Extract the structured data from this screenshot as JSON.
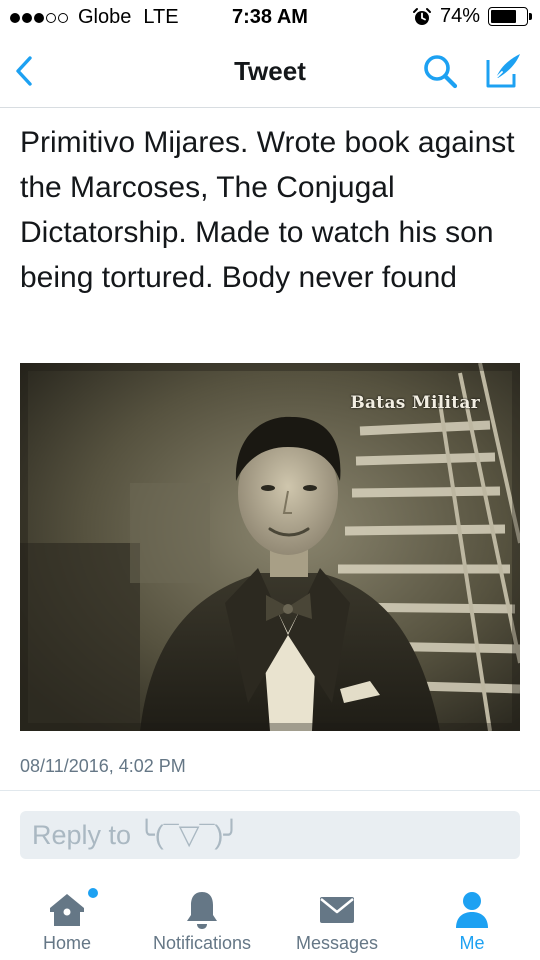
{
  "status_bar": {
    "carrier": "Globe",
    "network": "LTE",
    "time": "7:38 AM",
    "battery_percent": "74%",
    "battery_level": 0.74,
    "signal_bars_filled": 3,
    "signal_bars_total": 5
  },
  "nav": {
    "title": "Tweet",
    "back_icon": "chevron-left-icon",
    "search_icon": "search-icon",
    "compose_icon": "compose-icon",
    "accent_color": "#1da1f2"
  },
  "tweet": {
    "text": "Primitivo Mijares. Wrote book against the Marcoses, The Conjugal Dictatorship. Made to watch his son being tortured. Body never found",
    "photo_watermark": "Batas Militar",
    "timestamp": "08/11/2016, 4:02 PM"
  },
  "reply": {
    "placeholder": "Reply to ╰(¯▽¯)╯"
  },
  "tab_bar": {
    "tabs": [
      {
        "label": "Home",
        "icon": "home-icon",
        "active": false,
        "badge": true
      },
      {
        "label": "Notifications",
        "icon": "bell-icon",
        "active": false,
        "badge": false
      },
      {
        "label": "Messages",
        "icon": "envelope-icon",
        "active": false,
        "badge": false
      },
      {
        "label": "Me",
        "icon": "person-icon",
        "active": true,
        "badge": false
      }
    ],
    "inactive_color": "#657786",
    "active_color": "#1da1f2"
  }
}
